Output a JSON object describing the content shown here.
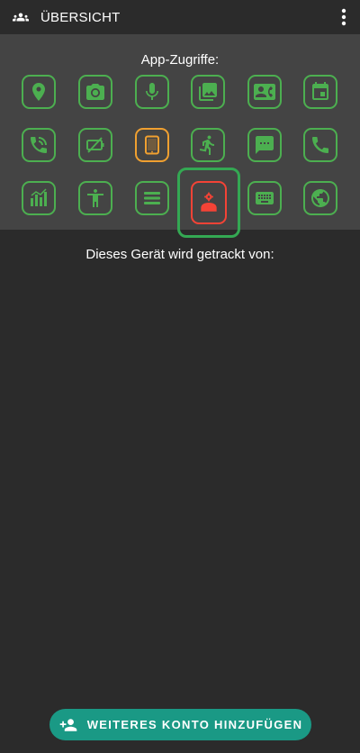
{
  "appbar": {
    "title": "ÜBERSICHT",
    "icon": "group-icon",
    "menu_icon": "more-vert-icon"
  },
  "panel": {
    "label": "App-Zugriffe:",
    "rows": [
      [
        {
          "name": "location-icon",
          "status": "green"
        },
        {
          "name": "camera-icon",
          "status": "green"
        },
        {
          "name": "microphone-icon",
          "status": "green"
        },
        {
          "name": "photos-icon",
          "status": "green"
        },
        {
          "name": "contacts-icon",
          "status": "green"
        },
        {
          "name": "calendar-icon",
          "status": "green"
        }
      ],
      [
        {
          "name": "call-log-icon",
          "status": "green"
        },
        {
          "name": "battery-off-icon",
          "status": "green"
        },
        {
          "name": "tablet-icon",
          "status": "orange"
        },
        {
          "name": "activity-icon",
          "status": "green"
        },
        {
          "name": "sms-icon",
          "status": "green"
        },
        {
          "name": "phone-icon",
          "status": "green"
        }
      ],
      [
        {
          "name": "usage-stats-icon",
          "status": "green"
        },
        {
          "name": "accessibility-icon",
          "status": "green"
        },
        {
          "name": "list-icon",
          "status": "green"
        },
        {
          "name": "device-admin-icon",
          "status": "red",
          "highlighted": true
        },
        {
          "name": "keyboard-icon",
          "status": "green"
        },
        {
          "name": "globe-icon",
          "status": "green"
        }
      ]
    ]
  },
  "tracked_label": "Dieses Gerät wird getrackt von:",
  "fab": {
    "label": "WEITERES KONTO HINZUFÜGEN",
    "icon": "person-add-icon"
  },
  "colors": {
    "green": "#4caf50",
    "orange": "#f0a030",
    "red": "#f44336",
    "accent": "#1a9985",
    "highlight": "#34a853"
  }
}
